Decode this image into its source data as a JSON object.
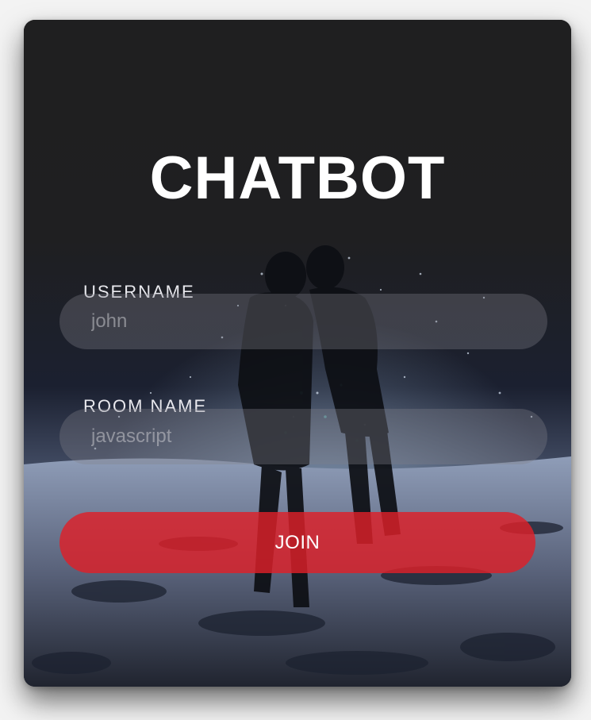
{
  "app": {
    "title": "CHATBOT"
  },
  "form": {
    "username": {
      "label": "USERNAME",
      "placeholder": "john",
      "value": ""
    },
    "room": {
      "label": "ROOM NAME",
      "placeholder": "javascript",
      "value": ""
    },
    "join_label": "JOIN"
  },
  "colors": {
    "card_background": "#1d1d1e",
    "accent": "#de2028",
    "text": "#ffffff"
  }
}
